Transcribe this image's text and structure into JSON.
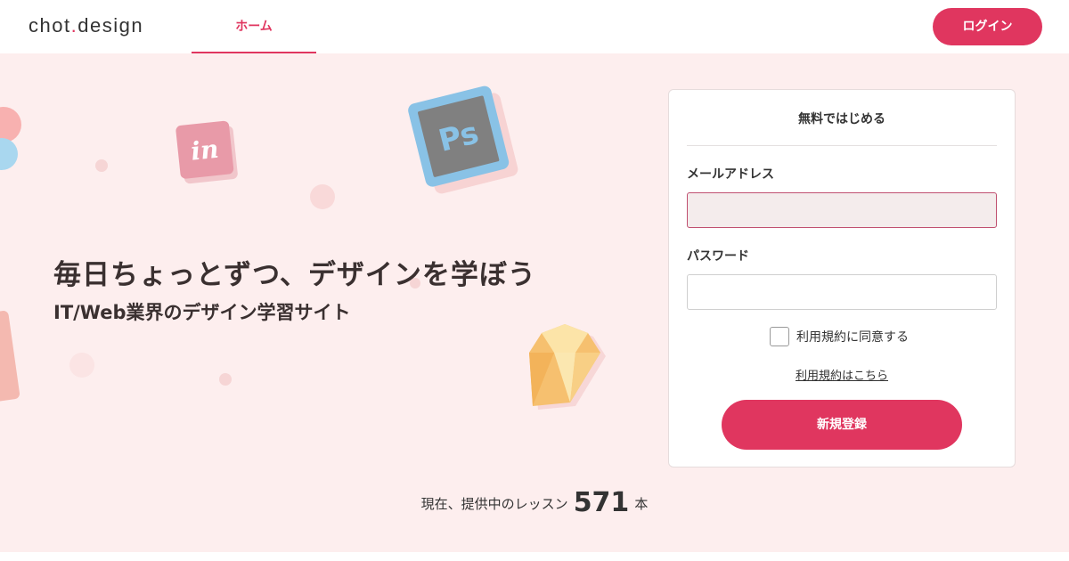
{
  "header": {
    "logo_part1": "chot",
    "logo_dot": ".",
    "logo_part2": "design",
    "tab_home": "ホーム",
    "login_label": "ログイン"
  },
  "hero": {
    "headline": "毎日ちょっとずつ、デザインを学ぼう",
    "subheadline": "IT/Web業界のデザイン学習サイト",
    "icons": [
      "invision-icon",
      "photoshop-icon",
      "sketch-icon"
    ]
  },
  "signup_form": {
    "title": "無料ではじめる",
    "email_label": "メールアドレス",
    "email_value": "",
    "password_label": "パスワード",
    "password_value": "",
    "terms_checkbox_label": "利用規約に同意する",
    "terms_checked": false,
    "terms_link": "利用規約はこちら",
    "submit_label": "新規登録"
  },
  "lesson_count": {
    "prefix": "現在、提供中のレッスン",
    "count": "571",
    "unit": "本"
  },
  "colors": {
    "accent": "#e0365f",
    "hero_bg": "#fdeeee",
    "text": "#3a3030"
  }
}
